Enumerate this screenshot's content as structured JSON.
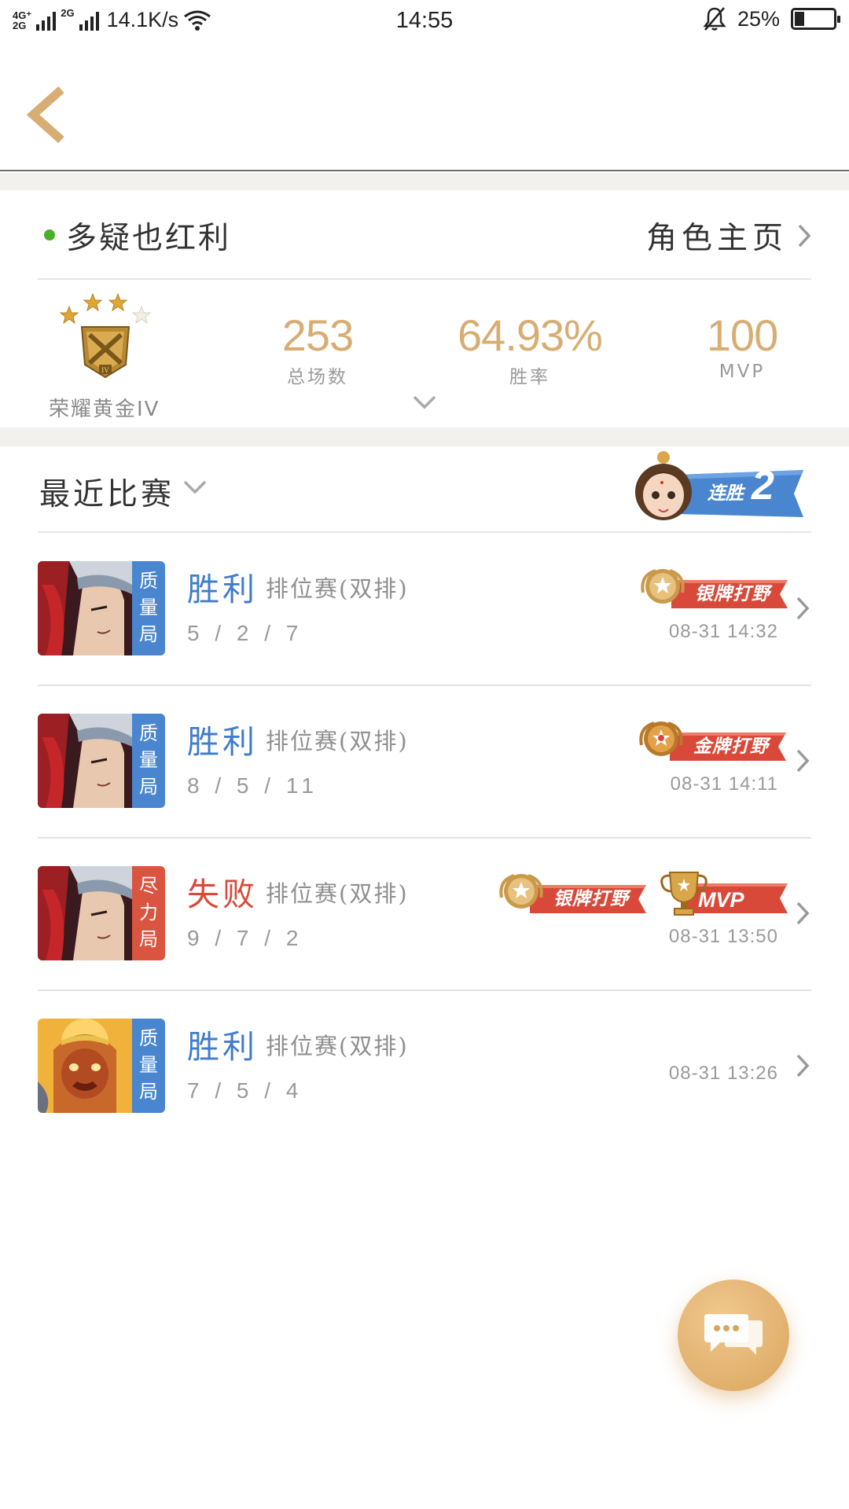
{
  "status_bar": {
    "net_top": "4G⁺",
    "net_bottom": "2G",
    "net2": "2G",
    "speed": "14.1K/s",
    "time": "14:55",
    "battery": "25%"
  },
  "player": {
    "name": "多疑也红利",
    "online": true,
    "profile_link": "角色主页"
  },
  "rank": {
    "label": "荣耀黄金IV",
    "stars_filled": 3,
    "stars_total": 4,
    "emblem_numeral": "IV"
  },
  "stats": [
    {
      "value": "253",
      "label": "总场数"
    },
    {
      "value": "64.93%",
      "label": "胜率"
    },
    {
      "value": "100",
      "label": "MVP"
    }
  ],
  "recent": {
    "title": "最近比赛",
    "streak_label": "连胜",
    "streak_count": "2"
  },
  "matches": [
    {
      "hero": "hero-red-hair",
      "tag": "质量局",
      "tag_color": "blue",
      "result": "胜利",
      "outcome": "win",
      "mode": "排位赛(双排)",
      "kda": "5 / 2 / 7",
      "time": "08-31 14:32",
      "badges": [
        {
          "kind": "silver",
          "text": "银牌打野"
        }
      ]
    },
    {
      "hero": "hero-red-hair",
      "tag": "质量局",
      "tag_color": "blue",
      "result": "胜利",
      "outcome": "win",
      "mode": "排位赛(双排)",
      "kda": "8 / 5 / 11",
      "time": "08-31 14:11",
      "badges": [
        {
          "kind": "gold",
          "text": "金牌打野"
        }
      ]
    },
    {
      "hero": "hero-red-hair",
      "tag": "尽力局",
      "tag_color": "red",
      "result": "失败",
      "outcome": "lose",
      "mode": "排位赛(双排)",
      "kda": "9 / 7 / 2",
      "time": "08-31 13:50",
      "badges": [
        {
          "kind": "silver",
          "text": "银牌打野"
        },
        {
          "kind": "mvp",
          "text": "MVP"
        }
      ]
    },
    {
      "hero": "hero-monkey-king",
      "tag": "质量局",
      "tag_color": "blue",
      "result": "胜利",
      "outcome": "win",
      "mode": "排位赛(双排)",
      "kda": "7 / 5 / 4",
      "time": "08-31 13:26",
      "badges": []
    }
  ],
  "colors": {
    "accent_gold": "#d8ad73",
    "win_blue": "#3f7ccc",
    "lose_red": "#d84a3a",
    "tag_blue": "#4a86cf",
    "tag_red": "#d9553f",
    "online_green": "#4caf2a"
  },
  "icons": {
    "back": "chevron-left-icon",
    "profile": "chevron-right-icon",
    "expand": "chevron-down-icon",
    "chat": "chat-bubbles-icon"
  }
}
